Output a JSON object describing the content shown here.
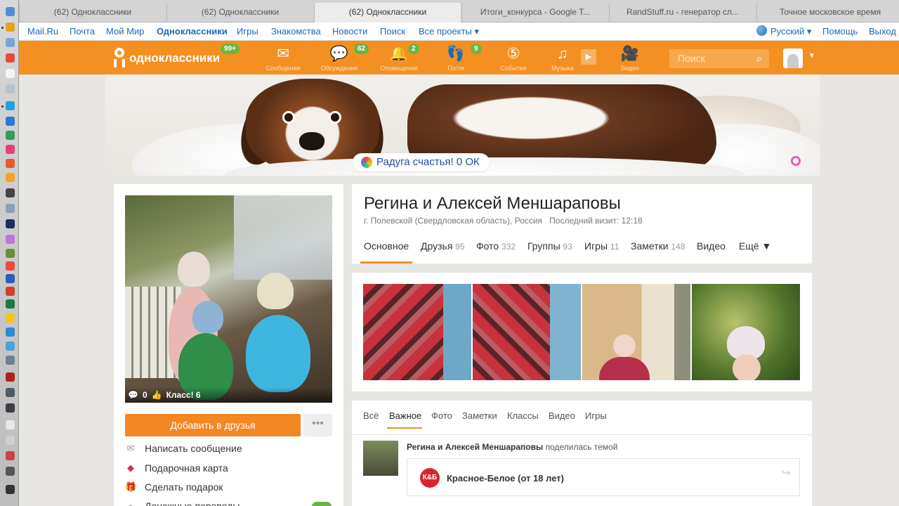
{
  "browser_tabs": [
    {
      "title": "(62) Одноклассники"
    },
    {
      "title": "(62) Одноклассники"
    },
    {
      "title": "(62) Одноклассники"
    },
    {
      "title": "Итоги_конкурса - Google T..."
    },
    {
      "title": "RandStuff.ru - генератор сл..."
    },
    {
      "title": "Точное московское время"
    }
  ],
  "portal": {
    "mailru": "Mail.Ru",
    "pochta": "Почта",
    "moimir": "Мой Мир",
    "odnoklassniki": "Одноклассники",
    "igry": "Игры",
    "znakomstva": "Знакомства",
    "novosti": "Новости",
    "poisk": "Поиск",
    "vse_proekty": "Все проекты ▾",
    "language": "Русский ▾",
    "help": "Помощь",
    "exit": "Выход"
  },
  "header": {
    "logo_text": "одноклассники",
    "logo_badge": "99+",
    "nav": [
      {
        "label": "Сообщения",
        "icon": "envelope-icon"
      },
      {
        "label": "Обсуждения",
        "icon": "chat-icon",
        "badge": "62"
      },
      {
        "label": "Оповещения",
        "icon": "bell-icon",
        "badge": "2"
      },
      {
        "label": "Гости",
        "icon": "footprints-icon",
        "badge": "9"
      },
      {
        "label": "События",
        "icon": "events-icon"
      },
      {
        "label": "Музыка",
        "icon": "music-icon"
      },
      {
        "label": "Видео",
        "icon": "video-camera-icon"
      }
    ],
    "search_placeholder": "Поиск"
  },
  "cover": {
    "rainbow_text": "Радуга счастья! 0 ОК"
  },
  "profile": {
    "name": "Регина и Алексей Меншараповы",
    "location": "г. Полевской (Свердловская область), Россия",
    "last_visit": "Последний визит: 12:18",
    "photo_comments": "0",
    "photo_likes": "Класс! 6",
    "add_friend": "Добавить в друзья",
    "more": "•••",
    "actions": [
      {
        "label": "Написать сообщение",
        "icon": "message-icon"
      },
      {
        "label": "Подарочная карта",
        "icon": "gift-card-icon"
      },
      {
        "label": "Сделать подарок",
        "icon": "gift-icon"
      },
      {
        "label": "Денежные переводы",
        "icon": "money-icon"
      }
    ],
    "tabs": [
      {
        "label": "Основное",
        "count": ""
      },
      {
        "label": "Друзья",
        "count": "95"
      },
      {
        "label": "Фото",
        "count": "332"
      },
      {
        "label": "Группы",
        "count": "93"
      },
      {
        "label": "Игры",
        "count": "11"
      },
      {
        "label": "Заметки",
        "count": "148"
      },
      {
        "label": "Видео",
        "count": ""
      },
      {
        "label": "Ещё ▼",
        "count": ""
      }
    ]
  },
  "feed": {
    "tabs": [
      "Всё",
      "Важное",
      "Фото",
      "Заметки",
      "Классы",
      "Видео",
      "Игры"
    ],
    "post_author": "Регина и Алексей Меншараповы",
    "post_action": "поделилась темой",
    "group_logo": "К&Б",
    "group_name": "Красное-Белое (от 18 лет)"
  },
  "colors": {
    "brand_orange": "#f39021",
    "badge_green": "#6cb43f",
    "link_blue": "#1e6ab5"
  }
}
